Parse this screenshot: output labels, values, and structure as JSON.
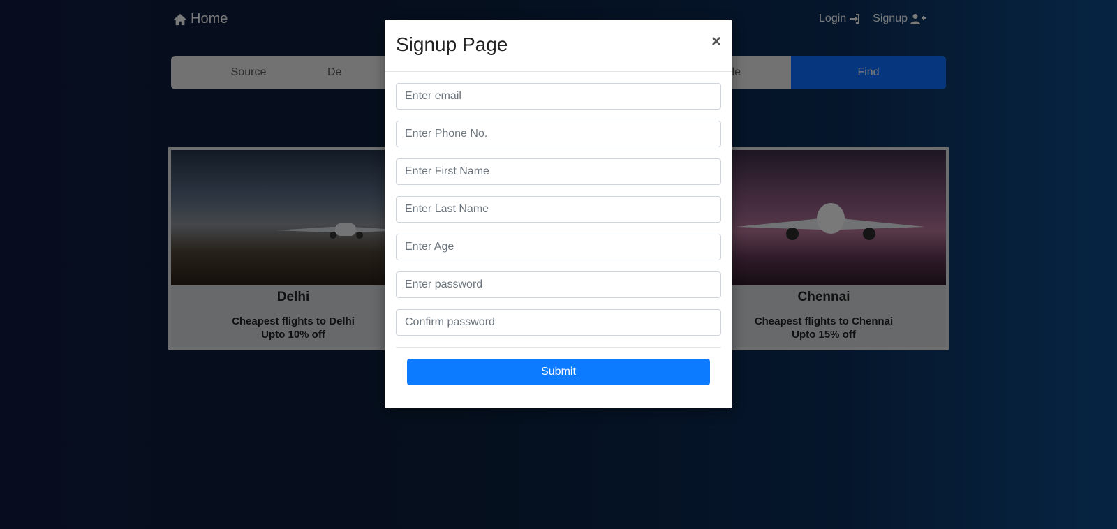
{
  "nav": {
    "home_label": "Home",
    "login_label": "Login",
    "signup_label": "Signup"
  },
  "search": {
    "source_label": "Source",
    "destination_partial": "De",
    "third_partial": "ple",
    "find_label": "Find"
  },
  "cards": [
    {
      "city": "Delhi",
      "line1": "Cheapest flights to Delhi",
      "line2": "Upto 10% off"
    },
    {
      "city": "Chennai",
      "line1": "Cheapest flights to Chennai",
      "line2": "Upto 15% off"
    }
  ],
  "modal": {
    "title": "Signup Page",
    "close_symbol": "×",
    "fields": [
      {
        "placeholder": "Enter email"
      },
      {
        "placeholder": "Enter Phone No."
      },
      {
        "placeholder": "Enter First Name"
      },
      {
        "placeholder": "Enter Last Name"
      },
      {
        "placeholder": "Enter Age"
      },
      {
        "placeholder": "Enter password"
      },
      {
        "placeholder": "Confirm password"
      }
    ],
    "submit_label": "Submit"
  },
  "colors": {
    "accent": "#0d6efd",
    "submit": "#0d7bff"
  }
}
